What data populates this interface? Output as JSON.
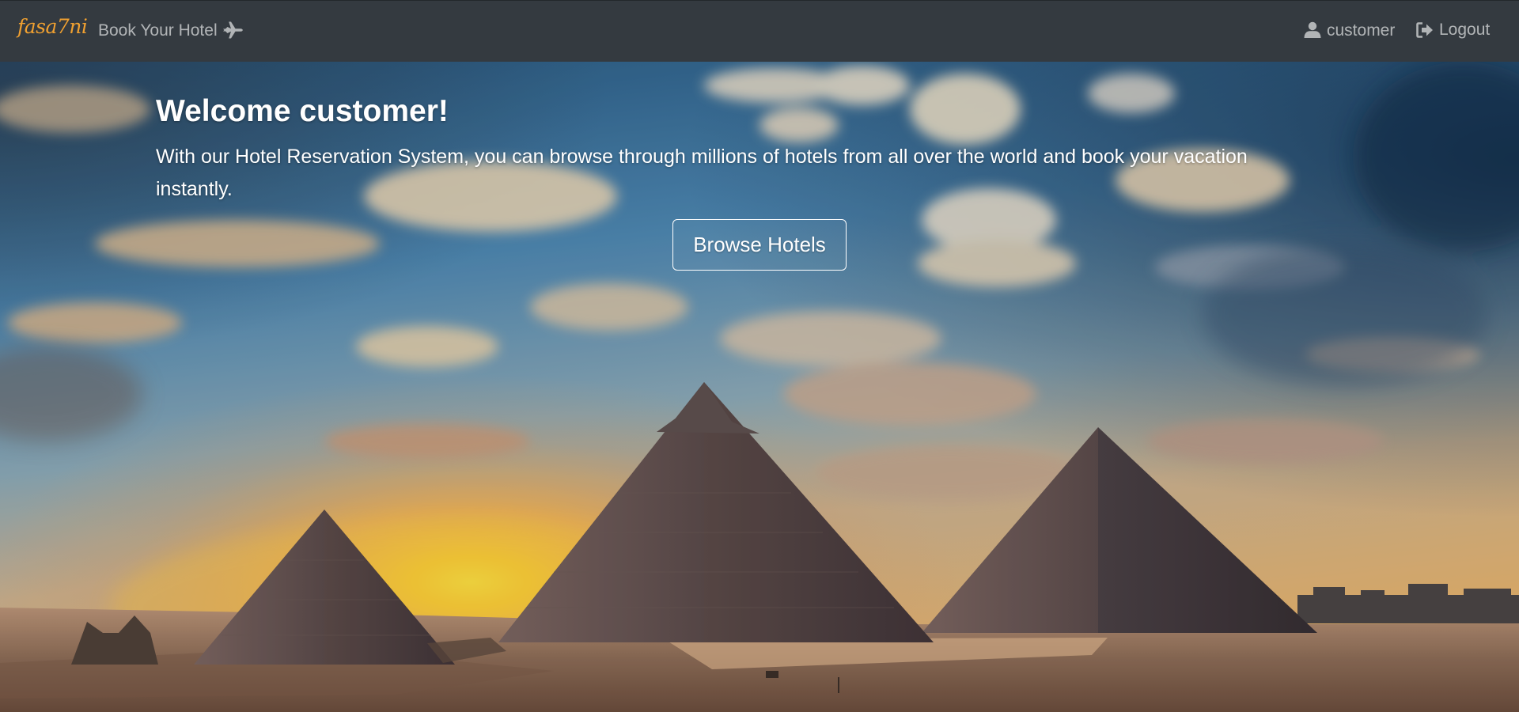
{
  "navbar": {
    "brand": "fasa7ni",
    "brand_color": "#f0a030",
    "background": "#343a40",
    "book_link": {
      "label": "Book Your Hotel",
      "icon": "plane-icon"
    },
    "user_link": {
      "label": "customer",
      "icon": "user-icon"
    },
    "logout_link": {
      "label": "Logout",
      "icon": "sign-out-icon"
    }
  },
  "hero": {
    "title": "Welcome customer!",
    "description": "With our Hotel Reservation System, you can browse through millions of hotels from all over the world and book your vacation instantly.",
    "browse_button": "Browse Hotels",
    "background_image": "pyramids-sunset-photo"
  }
}
